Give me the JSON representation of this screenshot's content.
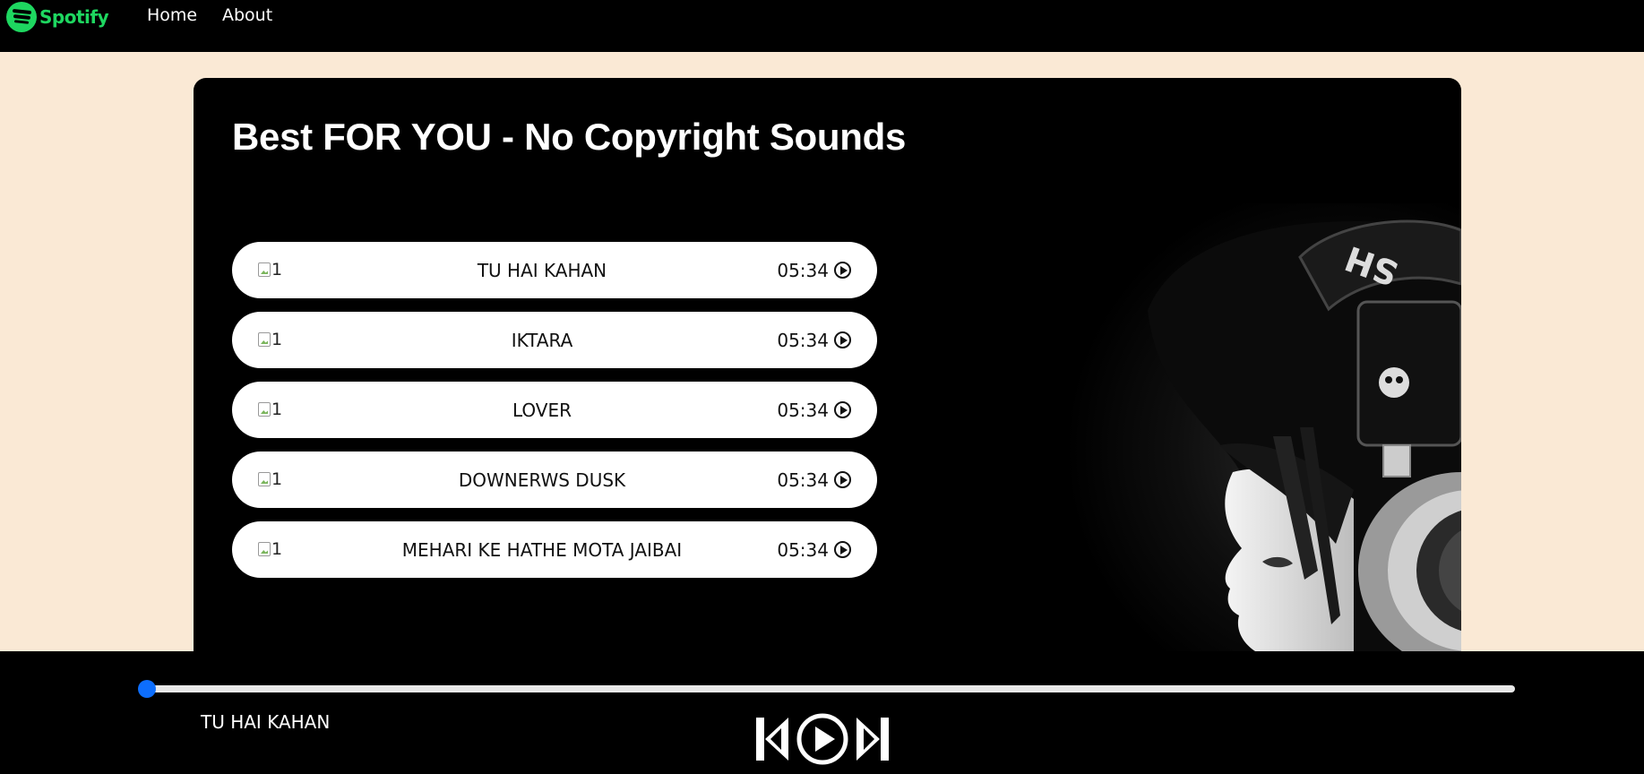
{
  "navbar": {
    "brand": "Spotify",
    "links": [
      "Home",
      "About"
    ]
  },
  "main": {
    "title": "Best FOR YOU - No Copyright Sounds",
    "songs": [
      {
        "img_alt": "1",
        "name": "TU HAI KAHAN",
        "duration": "05:34"
      },
      {
        "img_alt": "1",
        "name": "IKTARA",
        "duration": "05:34"
      },
      {
        "img_alt": "1",
        "name": "LOVER",
        "duration": "05:34"
      },
      {
        "img_alt": "1",
        "name": "DOWNERWS DUSK",
        "duration": "05:34"
      },
      {
        "img_alt": "1",
        "name": "MEHARI KE HATHE MOTA JAIBAI",
        "duration": "05:34"
      }
    ]
  },
  "player": {
    "now_playing": "TU HAI KAHAN",
    "progress": 0,
    "controls": [
      "previous-icon",
      "play-icon",
      "next-icon"
    ]
  },
  "colors": {
    "brand": "#1ed760",
    "background": "#fae9d5",
    "accent": "#0d6efd"
  }
}
